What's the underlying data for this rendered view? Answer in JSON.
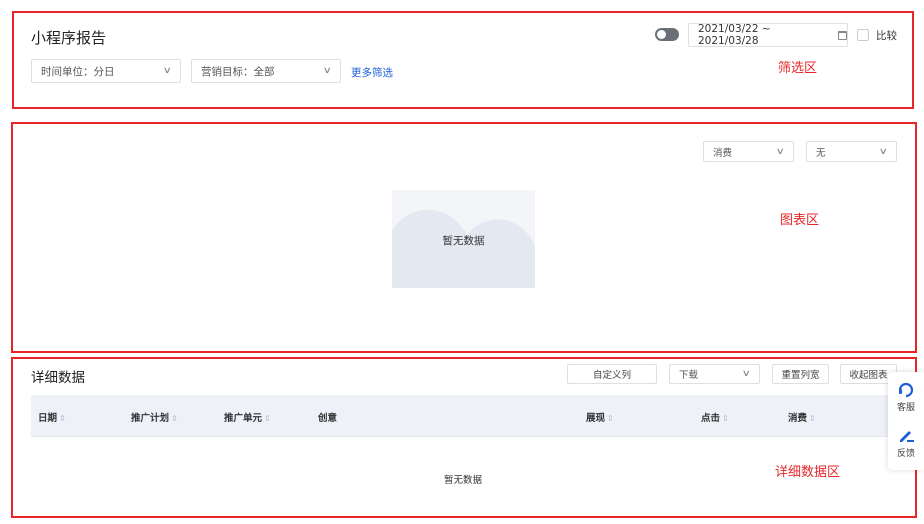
{
  "filter": {
    "page_title": "小程序报告",
    "date_range": "2021/03/22 ~ 2021/03/28",
    "compare_label": "比较",
    "time_unit": "时间单位：分日",
    "marketing_goal": "营销目标：全部",
    "more_filters": "更多筛选",
    "region_label": "筛选区"
  },
  "chart": {
    "metric_select": "消费",
    "compare_select": "无",
    "empty_text": "暂无数据",
    "region_label": "图表区"
  },
  "detail": {
    "title": "详细数据",
    "custom_columns": "自定义列",
    "download": "下载",
    "reset_width": "重置列宽",
    "collapse_chart": "收起图表",
    "columns": [
      "日期",
      "推广计划",
      "推广单元",
      "创意",
      "展现",
      "点击",
      "消费"
    ],
    "empty_text": "暂无数据",
    "region_label": "详细数据区"
  },
  "float": {
    "service": "客服",
    "feedback": "反馈"
  },
  "colors": {
    "annotation": "#e8262a",
    "link": "#1f5fd6",
    "table_header": "#eef1f8"
  }
}
